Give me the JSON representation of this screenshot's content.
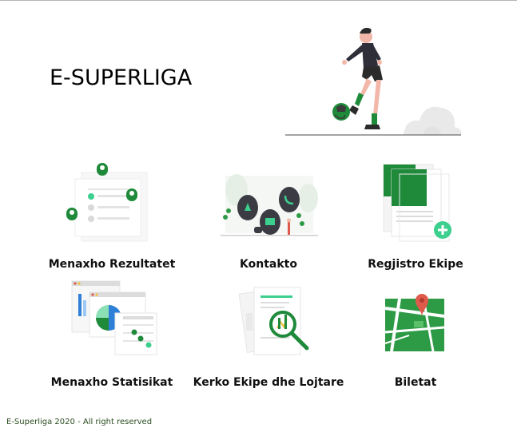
{
  "header": {
    "title": "E-SUPERLIGA"
  },
  "menu": {
    "items": [
      {
        "label": "Menaxho Rezultatet",
        "icon": "results-illustration-icon"
      },
      {
        "label": "Kontakto",
        "icon": "contact-illustration-icon"
      },
      {
        "label": "Regjistro Ekipe",
        "icon": "register-team-illustration-icon"
      },
      {
        "label": "Menaxho Statisikat",
        "icon": "statistics-illustration-icon"
      },
      {
        "label": "Kerko Ekipe dhe Lojtare",
        "icon": "search-illustration-icon"
      },
      {
        "label": "Biletat",
        "icon": "map-tickets-illustration-icon"
      }
    ]
  },
  "footer": {
    "text": "E-Superliga 2020 - All right reserved"
  },
  "colors": {
    "accent": "#1e8a3a",
    "accent_light": "#3ccf8e",
    "text": "#111111"
  }
}
